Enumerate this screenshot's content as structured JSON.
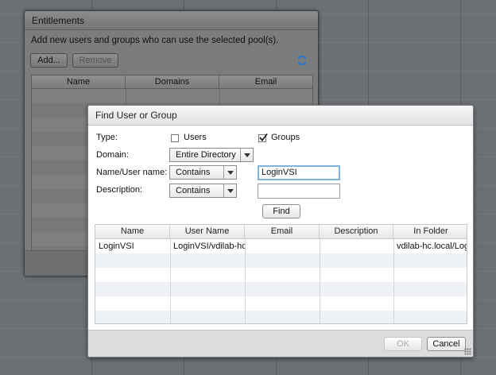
{
  "entitlements": {
    "title": "Entitlements",
    "description": "Add new users and groups who can use the selected pool(s).",
    "add_label": "Add...",
    "remove_label": "Remove",
    "columns": [
      "Name",
      "Domains",
      "Email"
    ],
    "refresh_icon": "refresh-icon"
  },
  "find_dialog": {
    "title": "Find User or Group",
    "type_label": "Type:",
    "users_label": "Users",
    "users_checked": false,
    "groups_label": "Groups",
    "groups_checked": true,
    "domain_label": "Domain:",
    "domain_value": "Entire Directory",
    "name_label": "Name/User name:",
    "name_match": "Contains",
    "name_value": "LoginVSI",
    "description_label": "Description:",
    "description_match": "Contains",
    "description_value": "",
    "find_label": "Find",
    "columns": [
      "Name",
      "User Name",
      "Email",
      "Description",
      "In Folder"
    ],
    "results": [
      {
        "name": "LoginVSI",
        "user_name": "LoginVSI/vdilab-hc",
        "email": "",
        "description": "",
        "in_folder": "vdilab-hc.local/Logi"
      }
    ],
    "ok_label": "OK",
    "cancel_label": "Cancel"
  },
  "colors": {
    "accent_focus": "#7eb4dc",
    "refresh_icon": "#2a78c8"
  }
}
